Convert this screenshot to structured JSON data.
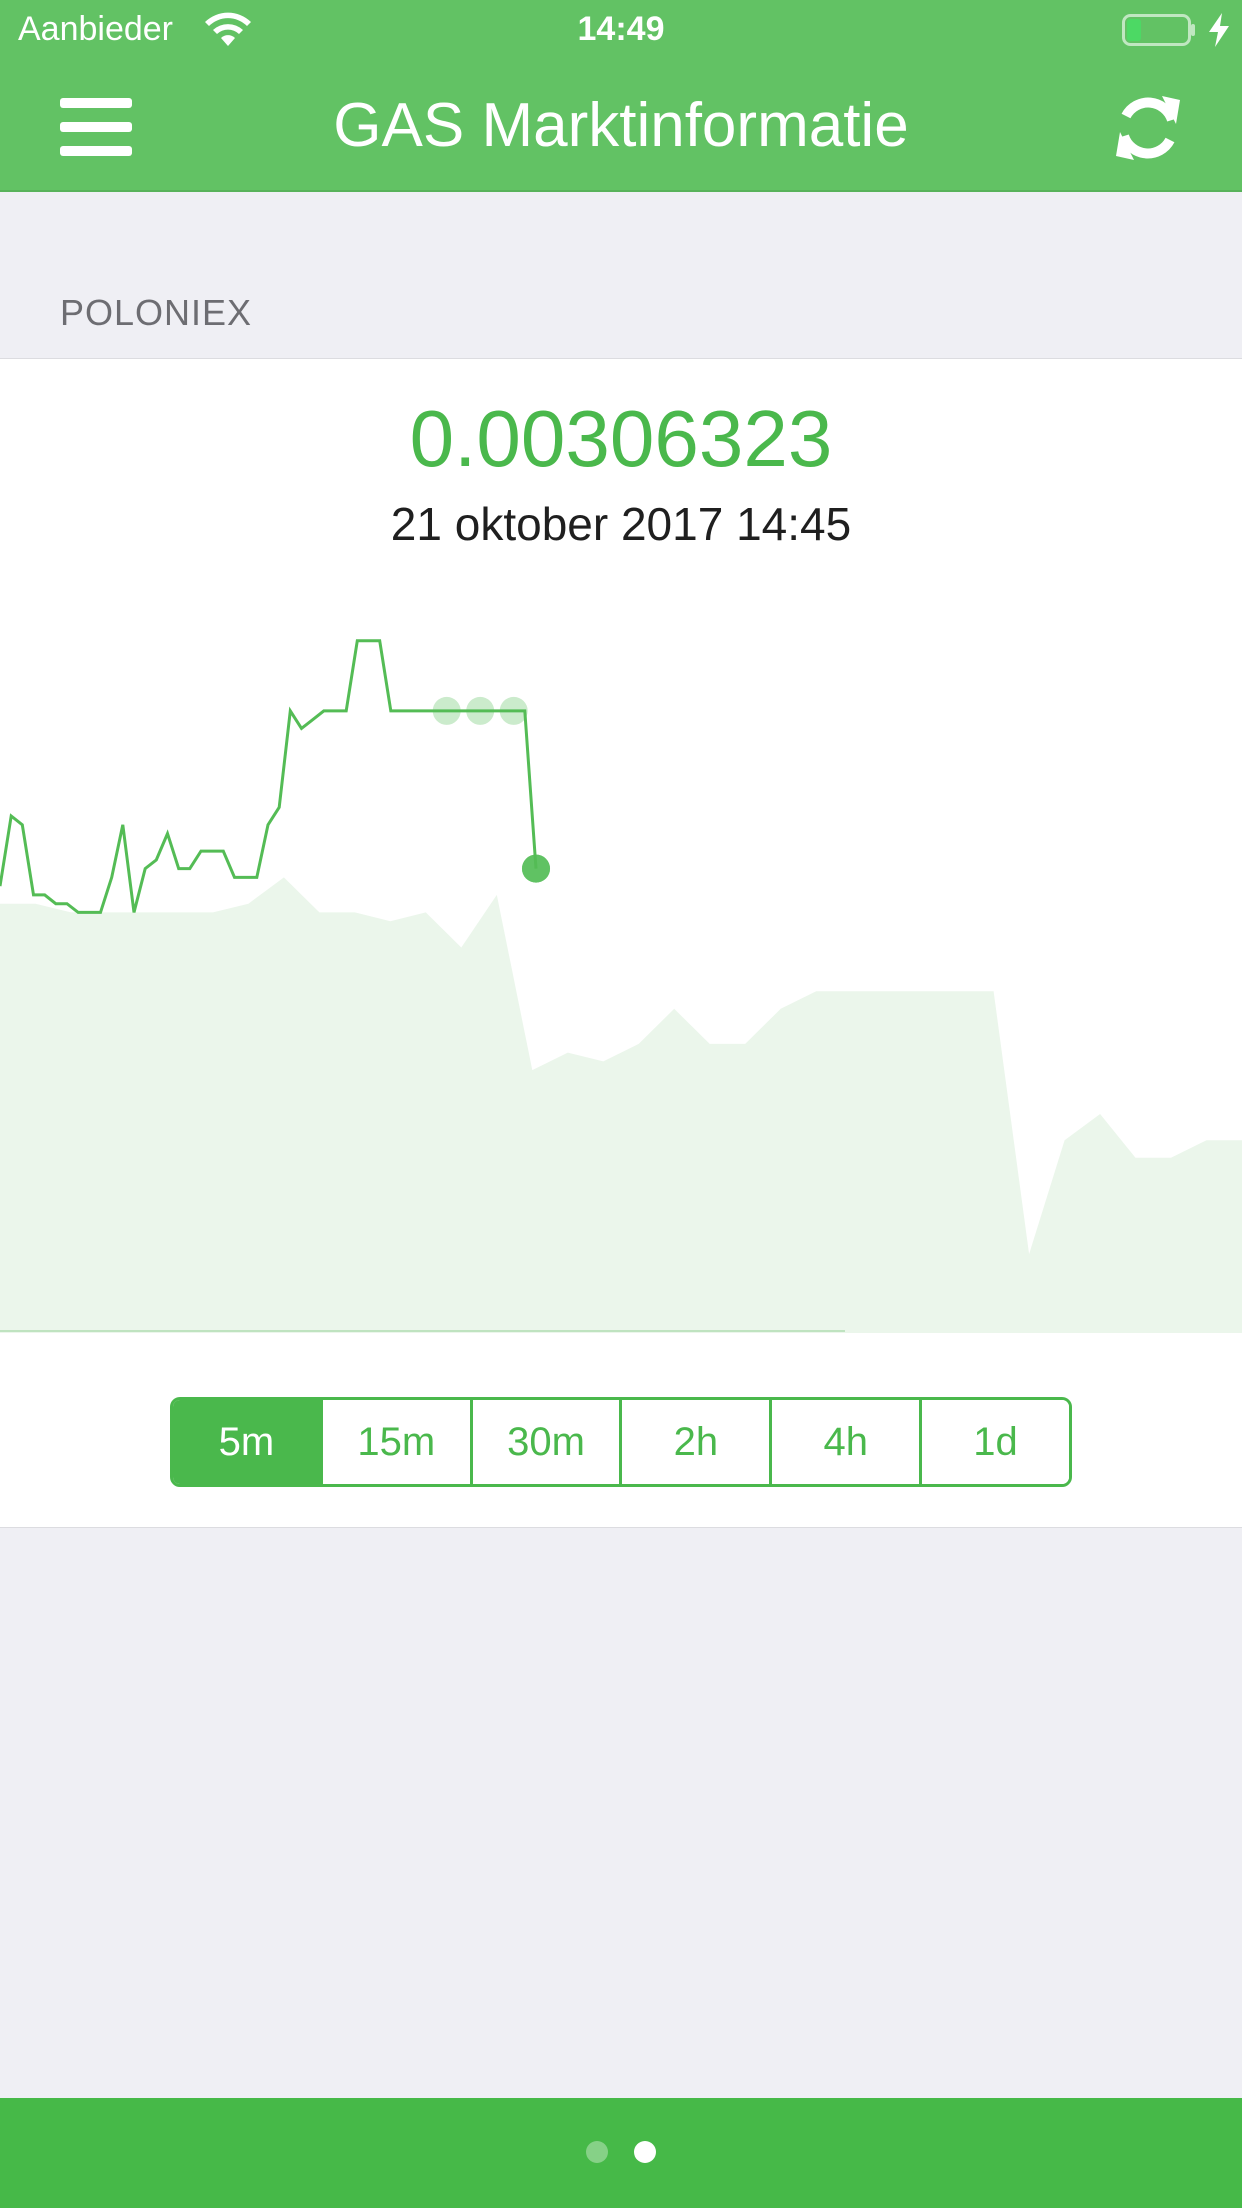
{
  "status_bar": {
    "carrier": "Aanbieder",
    "time": "14:49",
    "wifi_icon": "wifi-icon",
    "battery_icon": "battery-charging-icon"
  },
  "nav": {
    "title": "GAS Marktinformatie",
    "menu_icon": "hamburger-menu-icon",
    "refresh_icon": "refresh-icon"
  },
  "section": {
    "header": "POLONIEX"
  },
  "price": {
    "value": "0.00306323",
    "timestamp": "21 oktober 2017 14:45"
  },
  "intervals": [
    {
      "label": "5m",
      "selected": true
    },
    {
      "label": "15m",
      "selected": false
    },
    {
      "label": "30m",
      "selected": false
    },
    {
      "label": "2h",
      "selected": false
    },
    {
      "label": "4h",
      "selected": false
    },
    {
      "label": "1d",
      "selected": false
    }
  ],
  "pager": {
    "count": 2,
    "active_index": 1
  },
  "colors": {
    "header_green": "#62c264",
    "accent_green": "#4ab84c",
    "line_green": "#54bc55",
    "area_fill": "#ebf6eb",
    "footer_green": "#46b948",
    "background": "#efeff4"
  },
  "chart_data": {
    "type": "line",
    "values": [
      0.002995,
      0.003035,
      0.00303,
      0.00299,
      0.00299,
      0.002985,
      0.002985,
      0.00298,
      0.00298,
      0.00298,
      0.003,
      0.00303,
      0.00298,
      0.003005,
      0.00301,
      0.003025,
      0.003005,
      0.003005,
      0.003015,
      0.003015,
      0.003015,
      0.003,
      0.003,
      0.003,
      0.00303,
      0.00304,
      0.003095,
      0.003085,
      0.00309,
      0.003095,
      0.003095,
      0.003095,
      0.003135,
      0.003135,
      0.003135,
      0.003095,
      0.003095,
      0.003095,
      0.003095,
      0.003095,
      0.003095,
      0.003095,
      0.003095,
      0.003095,
      0.003095,
      0.003095,
      0.003095,
      0.003095,
      0.003005
    ],
    "highlight_points": [
      6,
      7,
      8,
      9,
      10,
      11,
      12,
      13,
      14,
      15
    ],
    "background_series": [
      0.002985,
      0.002985,
      0.00298,
      0.00298,
      0.00298,
      0.00298,
      0.00298,
      0.002985,
      0.003,
      0.00298,
      0.00298,
      0.002975,
      0.00298,
      0.00296,
      0.00299,
      0.00289,
      0.0029,
      0.002895,
      0.002905,
      0.002925,
      0.002905,
      0.002905,
      0.002925,
      0.002935,
      0.002935,
      0.002935,
      0.002935,
      0.002935,
      0.002935,
      0.002785,
      0.00285,
      0.002865,
      0.00284,
      0.00284,
      0.00285,
      0.00285
    ],
    "ylim": [
      0.00274,
      0.00316
    ],
    "grid": false
  }
}
